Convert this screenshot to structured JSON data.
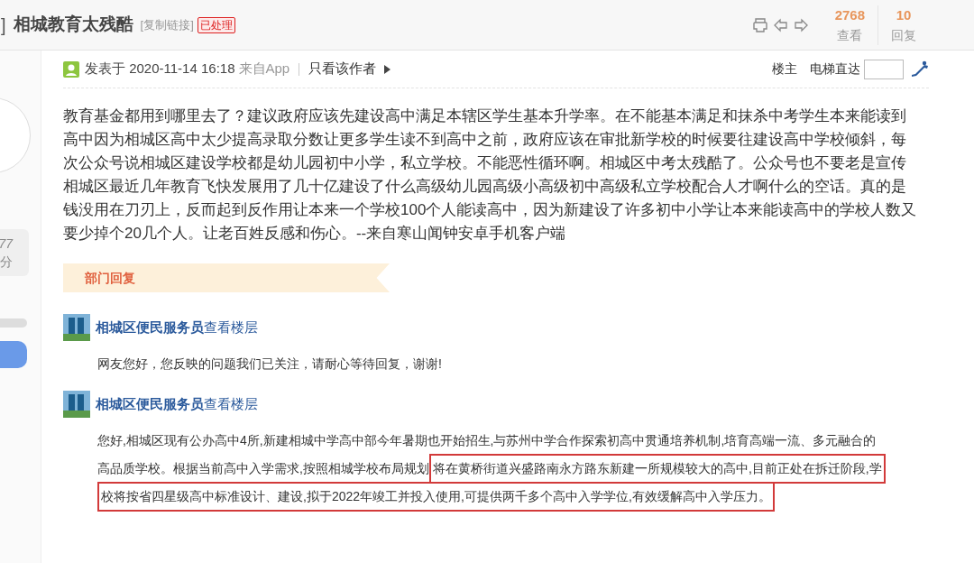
{
  "header": {
    "bracket": "]",
    "title": "相城教育太残酷",
    "copy_link": "[复制链接]",
    "status_badge": "已处理",
    "stats": [
      {
        "value": "2768",
        "label": "查看"
      },
      {
        "value": "10",
        "label": "回复"
      }
    ]
  },
  "sidebar": {
    "score_value": "77",
    "score_unit": "分"
  },
  "post": {
    "posted": "发表于 2020-11-14 16:18",
    "source": "来自App",
    "author_only": "只看该作者",
    "floor": "楼主",
    "jump_label": "电梯直达",
    "body": "教育基金都用到哪里去了？建议政府应该先建设高中满足本辖区学生基本升学率。在不能基本满足和抹杀中考学生本来能读到高中因为相城区高中太少提高录取分数让更多学生读不到高中之前，政府应该在审批新学校的时候要往建设高中学校倾斜，每次公众号说相城区建设学校都是幼儿园初中小学，私立学校。不能恶性循环啊。相城区中考太残酷了。公众号也不要老是宣传相城区最近几年教育飞快发展用了几十亿建设了什么高级幼儿园高级小高级初中高级私立学校配合人才啊什么的空话。真的是钱没用在刀刃上，反而起到反作用让本来一个学校100个人能读高中，因为新建设了许多初中小学让本来能读高中的学校人数又要少掉个20几个人。让老百姓反感和伤心。--来自寒山闻钟安卓手机客户端"
  },
  "dept_reply": {
    "heading": "部门回复",
    "replies": [
      {
        "name": "相城区便民服务员",
        "link": "查看楼层",
        "lines": [
          [
            {
              "text": "网友您好，您反映的问题我们已关注，请耐心等待回复，谢谢!",
              "highlighted": false
            }
          ]
        ]
      },
      {
        "name": "相城区便民服务员",
        "link": "查看楼层",
        "lines": [
          [
            {
              "text": "您好,相城区现有公办高中4所,新建相城中学高中部今年暑期也开始招生,与苏州中学合作探索初高中贯通培养机制,培育高端一流、多元融合的",
              "highlighted": false
            }
          ],
          [
            {
              "text": "高品质学校。根据当前高中入学需求,按照相城学校布局规划",
              "highlighted": false
            },
            {
              "text": "将在黄桥街道兴盛路南永方路东新建一所规模较大的高中,目前正处在拆迁阶段,学",
              "highlighted": true
            }
          ],
          [
            {
              "text": "校将按省四星级高中标准设计、建设,拟于2022年竣工并投入使用,可提供两千多个高中入学学位,有效缓解高中入学压力。",
              "highlighted": true
            }
          ]
        ]
      }
    ]
  }
}
